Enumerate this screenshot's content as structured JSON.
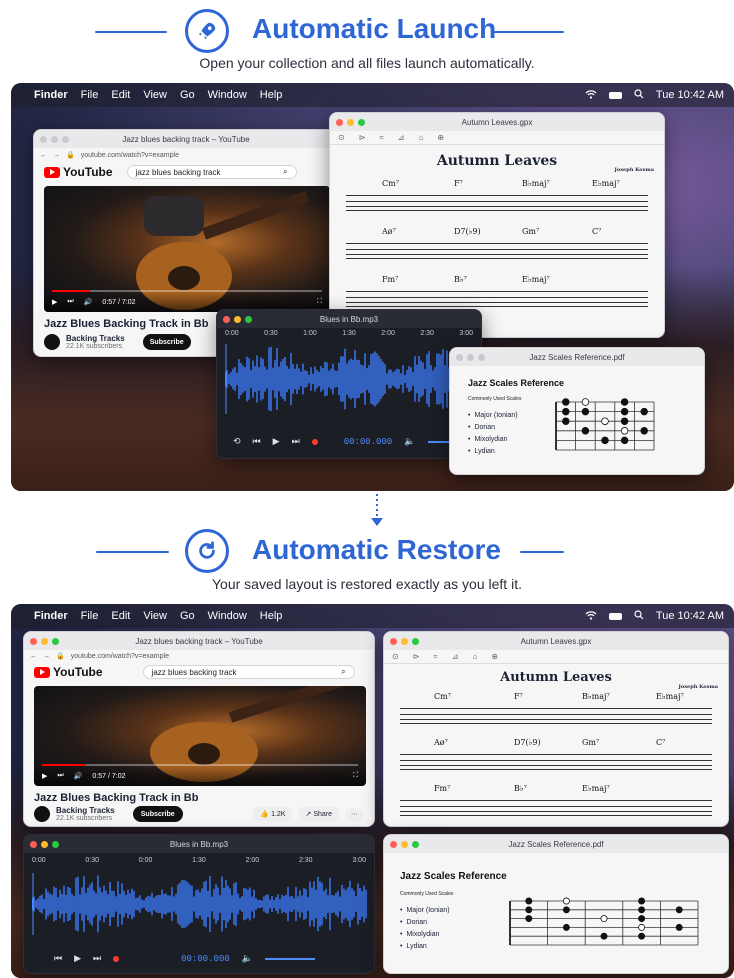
{
  "section1": {
    "title": "Automatic Launch",
    "subtitle": "Open your collection and all files launch automatically."
  },
  "section2": {
    "title": "Automatic Restore",
    "subtitle": "Your saved layout is restored exactly as you left it."
  },
  "menubar": {
    "items": [
      "Finder",
      "File",
      "Edit",
      "View",
      "Go",
      "Window",
      "Help"
    ],
    "clock": "Tue 10:42 AM"
  },
  "youtube": {
    "window_title": "Jazz blues backing track – YouTube",
    "url": "youtube.com/watch?v=example",
    "logo": "YouTube",
    "search": "jazz blues backing track",
    "time": "0:57 / 7:02",
    "video_title": "Jazz Blues Backing Track in Bb",
    "channel": "Backing Tracks",
    "subscribers": "22.1K subscribers",
    "subscribe": "Subscribe",
    "likes": "1.2K",
    "share": "Share",
    "more": "···",
    "progress_fraction": 0.14
  },
  "score": {
    "window_title": "Autumn Leaves.gpx",
    "title": "Autumn Leaves",
    "composer": "Joseph Kosma",
    "row1": [
      "Cm⁷",
      "F⁷",
      "B♭maj⁷",
      "E♭maj⁷"
    ],
    "row2": [
      "Aø⁷",
      "D7(♭9)",
      "Gm⁷",
      "C⁷"
    ],
    "row3": [
      "Fm⁷",
      "B♭⁷",
      "E♭maj⁷"
    ]
  },
  "player": {
    "window_title": "Blues in Bb.mp3",
    "ticks": [
      "0:00",
      "0:30",
      "1:00",
      "1:30",
      "2:00",
      "2:30",
      "3:00"
    ],
    "ticks2": [
      "0:00",
      "0:30",
      "0:00",
      "1:30",
      "2:00",
      "2:30",
      "3:00"
    ],
    "time": "00:00.000",
    "volume_fraction": 0.72
  },
  "pdf": {
    "window_title": "Jazz Scales Reference.pdf",
    "title": "Jazz Scales Reference",
    "subtitle": "Commonly Used Scales",
    "scales": [
      "Major (Ionian)",
      "Dorian",
      "Mixolydian",
      "Lydian"
    ]
  }
}
